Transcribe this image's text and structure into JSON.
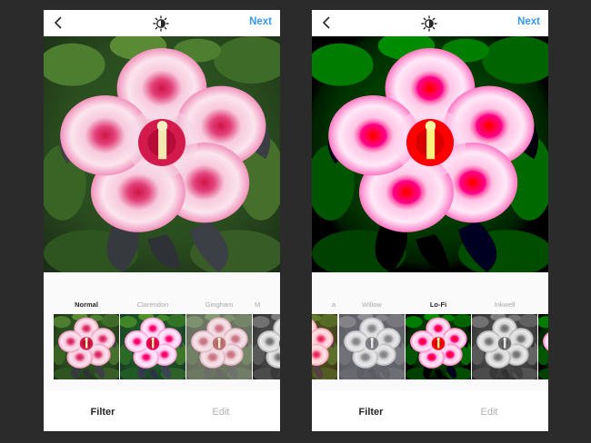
{
  "screens": [
    {
      "back_icon": "chevron-left-icon",
      "lux_icon": "lux-sun-icon",
      "next_label": "Next",
      "selected_filter": "Normal",
      "filters": [
        {
          "label": "Normal",
          "style": "normal"
        },
        {
          "label": "Clarendon",
          "style": "clarendon"
        },
        {
          "label": "Gingham",
          "style": "gingham"
        },
        {
          "label": "M",
          "style": "mono"
        }
      ],
      "tabs": {
        "filter": "Filter",
        "edit": "Edit"
      }
    },
    {
      "back_icon": "chevron-left-icon",
      "lux_icon": "lux-sun-icon",
      "next_label": "Next",
      "selected_filter": "Lo-Fi",
      "filters": [
        {
          "label": "a",
          "style": "warm"
        },
        {
          "label": "Willow",
          "style": "willow"
        },
        {
          "label": "Lo-Fi",
          "style": "lofi"
        },
        {
          "label": "Inkwell",
          "style": "inkwell"
        },
        {
          "label": "",
          "style": "lofi"
        }
      ],
      "tabs": {
        "filter": "Filter",
        "edit": "Edit"
      }
    }
  ],
  "colors": {
    "accent": "#3897f0",
    "background": "#2b2b2b",
    "petal_pink": "#f3a6c8",
    "flower_center": "#c4103e"
  }
}
